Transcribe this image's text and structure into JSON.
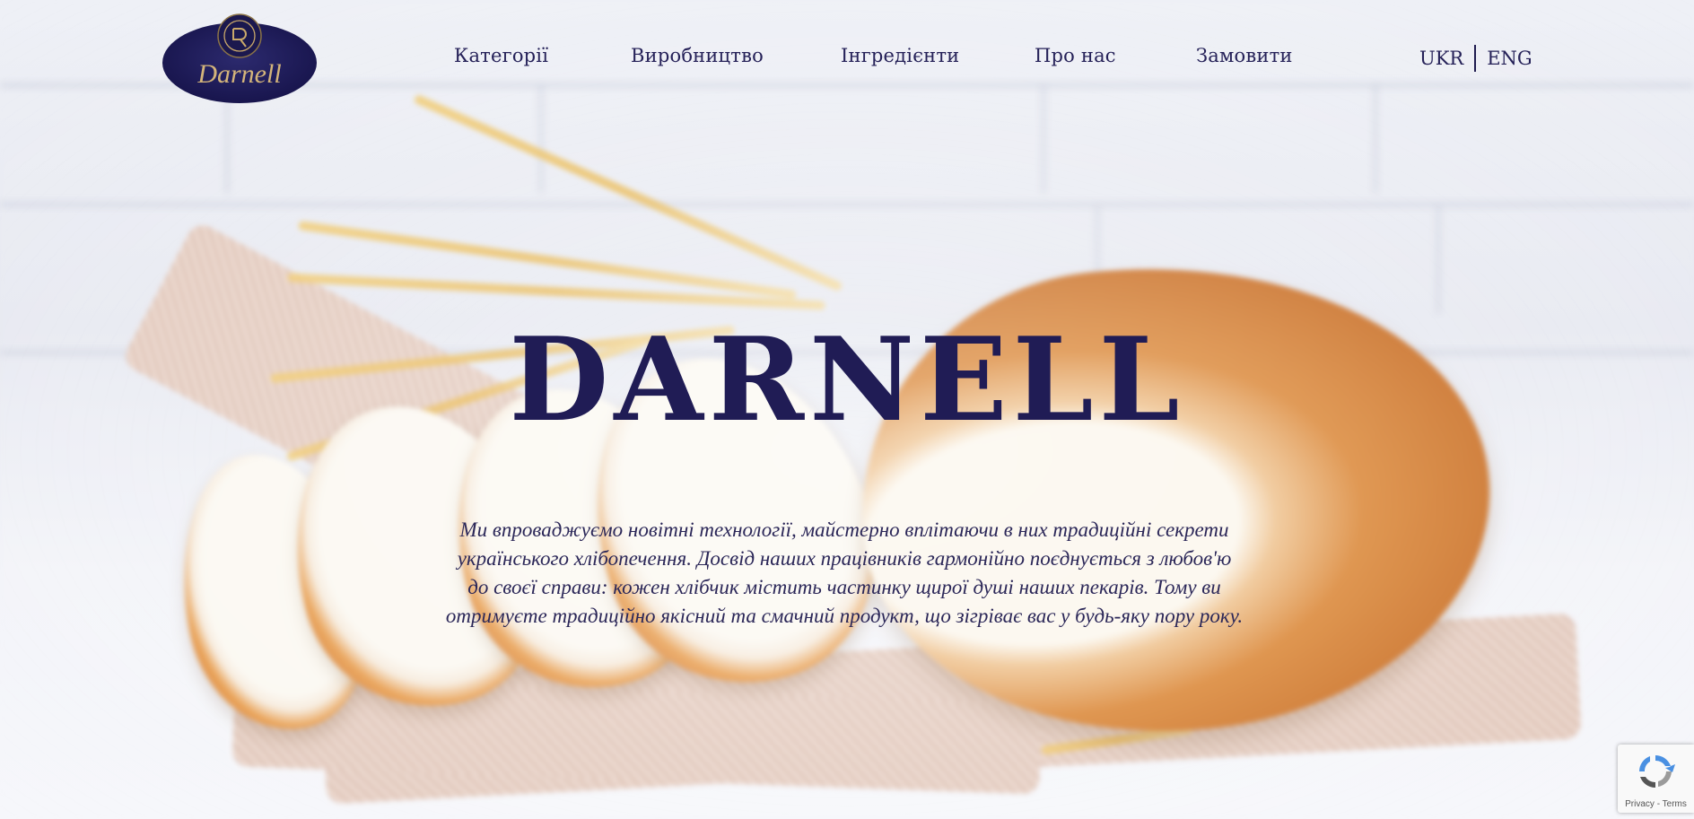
{
  "brand": {
    "logo_text": "Darnell",
    "hero_title": "DARNELL",
    "primary_color": "#201c55",
    "accent_gold": "#c9a86a"
  },
  "nav": {
    "items": [
      {
        "label": "Категорії"
      },
      {
        "label": "Виробництво"
      },
      {
        "label": "Інгредієнти"
      },
      {
        "label": "Про нас"
      },
      {
        "label": "Замовити"
      }
    ]
  },
  "lang": {
    "ukr": "UKR",
    "eng": "ENG"
  },
  "hero": {
    "lines": [
      "Ми впроваджуємо новітні технології, майстерно вплітаючи в них традиційні секрети",
      "українського хлібопечення. Досвід наших працівників гармонійно поєднується з любов'ю",
      "до своєї справи: кожен хлібчик містить частинку щирої душі наших пекарів. Тому ви",
      "отримуєте традиційно якісний та смачний продукт, що зігріває вас у будь-яку пору року."
    ]
  },
  "recaptcha": {
    "privacy": "Privacy",
    "separator": " - ",
    "terms": "Terms",
    "icon": "recaptcha-icon"
  }
}
